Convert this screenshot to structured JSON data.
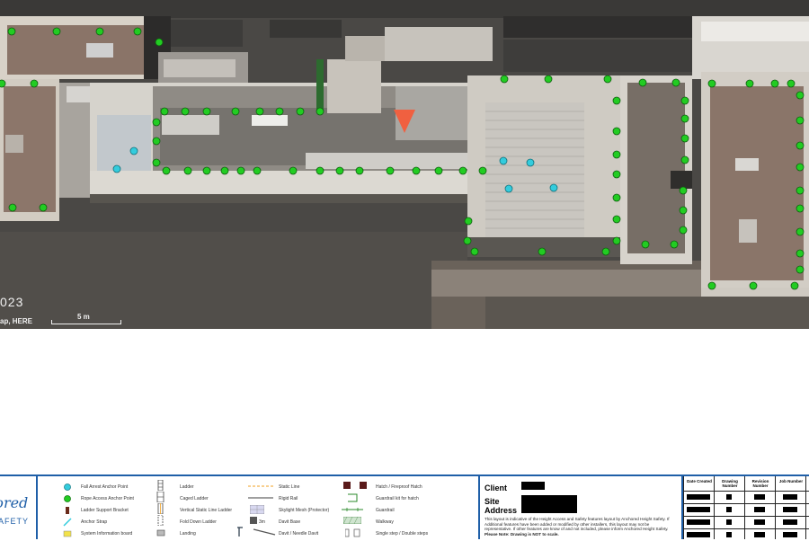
{
  "map": {
    "year_label": "023",
    "attribution": "ap, HERE",
    "scale_label": "5 m"
  },
  "colors": {
    "rope_access_anchor": "#22cc22",
    "fall_arrest_anchor": "#33ccdd",
    "marker": "#f06040",
    "border_blue": "#1f5fa8"
  },
  "footer": {
    "logo": {
      "word1": "hored",
      "word2": "AFETY"
    },
    "legend": [
      {
        "label": "Fall Arrest Anchor Point",
        "icon": "fall-arrest-anchor-icon"
      },
      {
        "label": "Rope Access Anchor Point",
        "icon": "rope-access-anchor-icon"
      },
      {
        "label": "Ladder Support Bracket",
        "icon": "ladder-support-bracket-icon"
      },
      {
        "label": "Anchor Strap",
        "icon": "anchor-strap-icon"
      },
      {
        "label": "System Information board",
        "icon": "information-board-icon"
      },
      {
        "label": "Ladder",
        "icon": "ladder-icon"
      },
      {
        "label": "Caged Ladder",
        "icon": "caged-ladder-icon"
      },
      {
        "label": "Vertical Static Line Ladder",
        "icon": "vertical-static-line-ladder-icon"
      },
      {
        "label": "Fold Down Ladder",
        "icon": "fold-down-ladder-icon"
      },
      {
        "label": "Landing",
        "icon": "landing-icon"
      },
      {
        "label": "Static Line",
        "icon": "static-line-icon"
      },
      {
        "label": "Rigid Rail",
        "icon": "rigid-rail-icon"
      },
      {
        "label": "Skylight Mesh (Protector)",
        "icon": "skylight-mesh-icon"
      },
      {
        "label": "Davit Base",
        "icon": "davit-base-icon"
      },
      {
        "label": "Davit / Needle Davit",
        "icon": "davit-icon"
      },
      {
        "label": "Hatch / Fireproof Hatch",
        "icon": "hatch-icon"
      },
      {
        "label": "Guardrail kit for hatch",
        "icon": "hatch-guardrail-icon"
      },
      {
        "label": "Guardrail",
        "icon": "guardrail-icon"
      },
      {
        "label": "Walkway",
        "icon": "walkway-icon"
      },
      {
        "label": "Single step / Double steps",
        "icon": "steps-icon"
      }
    ],
    "davit_base_size": "3m",
    "client_label": "Client",
    "site_label": "Site Address",
    "disclaimer": "This layout is indicative of the Height Access and Safety features layout by Anchored Height Safety.  If Additional features have been added or modified by other installers, this layout may not be representative.  If other features are know of and not included, please inform Anchored Height Safety.",
    "disclaimer_note": "Please Note: Drawing is NOT to scale.",
    "revision_table": {
      "headers": [
        "Date Created",
        "Drawing Number",
        "Revision Number",
        "Job Number"
      ]
    }
  }
}
